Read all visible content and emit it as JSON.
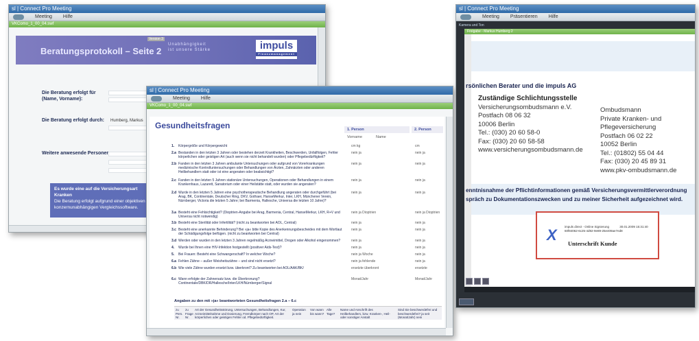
{
  "window1": {
    "title": "sl | Connect Pro Meeting",
    "menu": [
      "Meeting",
      "Hilfe"
    ],
    "tab": "VKComo_1_00_04.swf",
    "banner_title": "Beratungsprotokoll – Seite 2",
    "version": "Version 3",
    "tagline": [
      "Unabhängigkeit",
      "ist unsere Stärke"
    ],
    "logo": "impuls",
    "logo_sub": "Finanzmanagement",
    "labels": {
      "beratung_fuer": "Die Beratung erfolgt für (Name, Vorname):",
      "beratung_durch": "Die Beratung erfolgt durch:",
      "weitere": "Weitere anwesende Personen:"
    },
    "berater_name": "Humberg, Markus",
    "note_line1": "Es wurde eine auf die Versicherungsart Kranken",
    "note_line2": "Die Beratung erfolgt aufgrund einer objektiven",
    "note_line3": "konzernunabhängigen Vergleichssoftware."
  },
  "window2": {
    "title": "sl | Connect Pro Meeting",
    "menu": [
      "Meeting",
      "Hilfe"
    ],
    "tab": "VKComo_1_00_04.swf",
    "heading": "Gesundheitsfragen",
    "person1": "1. Person",
    "person2": "2. Person",
    "vorname": "Vorname",
    "name": "Name",
    "questions": [
      {
        "num": "1.",
        "text": "Körpergröße und Körpergewicht",
        "a": "cm    kg",
        "b": "cm"
      },
      {
        "num": "2.a",
        "text": "Bestanden in den letzten 3 Jahren oder bestehen derzeit Krankheiten, Beschwerden, Unfallfolgen, Fehler körperlichen oder geistigen Art (auch wenn sie nicht behandelt wurden) oder Pflegebedürftigkeit?",
        "a": "nein  ja",
        "b": "nein  ja"
      },
      {
        "num": "2.b",
        "text": "Fanden in den letzten 3 Jahren ambulante Untersuchungen oder aufgrund von Vorerkrankungen medizinische Kontrolluntersuchungen oder Behandlungen von Ärzten, Zahnärzten oder anderen Heilbehandlern statt oder ist eine angeraten oder beabsichtigt?",
        "a": "nein  ja",
        "b": "nein  ja"
      },
      {
        "num": "2.c",
        "text": "Fanden in den letzten 5 Jahren stationäre Untersuchungen, Operationen oder Behandlungen in einem Krankenhaus, Lazarett, Sanatorium oder einer Heilstätte statt, oder wurden sie angeraten?",
        "a": "nein  ja",
        "b": "nein  ja"
      },
      {
        "num": "2.d",
        "text": "Wurde in den letzten 5 Jahren eine psychotherapeutische Behandlung angeraten oder durchgeführt (bei Arag, BK, Continentale, Deutscher Ring, DKV, Gothaer, HanseMerkur, Inter, LKH, Münchener Verein, Nürnberger, Victoria die letzten 5 Jahre; bei Barmenia, Hallesche, Universa die letzten 10 Jahre)?",
        "a": "nein  ja",
        "b": "nein  ja"
      },
      {
        "num": "3.a",
        "text": "Besteht eine Fehlsichtigkeit? (Dioptrien-Angabe bei Arag, Barmenia, Central, HanseMerkur, LKH, R+V und Universa nicht notwendig)",
        "a": "nein  ja  Dioptrien",
        "b": "nein  ja  Dioptrien"
      },
      {
        "num": "3.b",
        "text": "Besteht eine Sterilität oder Infertilität? (nicht zu beantworten bei AOL, Central)",
        "a": "nein  ja",
        "b": "nein  ja"
      },
      {
        "num": "3.c",
        "text": "Besteht eine anerkannte Behinderung? Bei »ja« bitte Kopie des Anerkennungsbescheides mit dem Wortlaut der Schädigungsfolge beifügen. (nicht zu beantworten bei Central)",
        "a": "nein  ja",
        "b": "nein  ja"
      },
      {
        "num": "3.d",
        "text": "Werden oder wurden in den letzten 3 Jahren regelmäßig Arzneimittel, Drogen oder Alkohol eingenommen?",
        "a": "nein  ja",
        "b": "nein  ja"
      },
      {
        "num": "4.",
        "text": "Wurde bei Ihnen eine HIV-Infektion festgestellt (positiver Aids-Test)?",
        "a": "nein  ja",
        "b": "nein  ja"
      },
      {
        "num": "5.",
        "text": "Bei Frauen: Besteht eine Schwangerschaft? In welcher Woche?",
        "a": "nein  ja   Woche",
        "b": "nein  ja"
      },
      {
        "num": "6.a",
        "text": "Fehlen Zähne – außer Weisheitszähne – und sind nicht ersetzt?",
        "a": "nein  ja   fehlende",
        "b": "nein  ja"
      },
      {
        "num": "6.b",
        "text": "Wie viele Zähne wurden ersetzt bzw. überkront?   Zu beantworten bei AOL/AAK/BK/",
        "a": "ersetzte   überkront",
        "b": "ersetzte"
      },
      {
        "num": "6.c",
        "text": "Wann erfolgte der Zahnersatz bzw. die Überkronung?   Continentale/DBK/DR/Hallesche/Inter/LKH/Nürnberger/Signal",
        "a": "Monat/Jahr",
        "b": "Monat/Jahr"
      }
    ],
    "footer_title": "Angaben zu den mit »ja« beantworteten Gesundheitsfragen 2.a – 6.c",
    "table_headers": [
      "zu Pers. Nr.",
      "zu Frage Nr.",
      "Art der Gesundheitsstörung, Untersuchungen, Behandlungen, Kur, Arzneimittelnahme und Dosierung, Fremdkörper nach OP, Art der körperlichen oder geistigen Fehler od. Pflegebedürftigkeit.",
      "Operation ja  nein",
      "Von wann bis wann?",
      "Alle Tage?",
      "Name und Anschrift des Heilbehandlers, bzw. Kranken-, Heil- oder sonstiger Anstalt",
      "Sind Sie beschwerdefrei und beschwerdefrei? ja  seit (Monat/Jahr)  nein"
    ]
  },
  "window3": {
    "title": "sl | Connect Pro Meeting",
    "menu": [
      "Meeting",
      "Präsentieren",
      "Hilfe"
    ],
    "tab": "Kamera und Ton",
    "share_label": "Freigabe - Markus Humberg 2",
    "header_line": "rsönlichen Berater und die impuls AG",
    "left_block": {
      "heading": "Zuständige Schlichtungsstelle",
      "lines": [
        "Versicherungsombudsmann e.V.",
        "Postfach 08 06 32",
        "10006 Berlin",
        "Tel.: (030) 20 60 58-0",
        "Fax: (030) 20 60 58-58",
        "www.versicherungsombudsmann.de"
      ]
    },
    "right_block": {
      "lines": [
        "Ombudsmann",
        "Private Kranken- und",
        "Pflegeversicherung",
        "Postfach 06 02 22",
        "10052 Berlin",
        "Tel.: (01802) 55 04 44",
        "Fax: (030) 20 45 89 31",
        "www.pkv-ombudsmann.de"
      ]
    },
    "info_line1": "enntnisnahme der Pflichtinformationen gemäß Versicherungsvermittlerverordnung",
    "info_line2": "spräch zu Dokumentationszwecken und zu meiner Sicherheit aufgezeichnet wird.",
    "signature": {
      "meta1": "impuls direct - Online Signierung",
      "meta_date": "30.01.2009 15:31:40",
      "meta2": "60f84062-6c25-4d92-9e89-25e409ae7ed8",
      "label": "Unterschrift Kunde"
    }
  }
}
